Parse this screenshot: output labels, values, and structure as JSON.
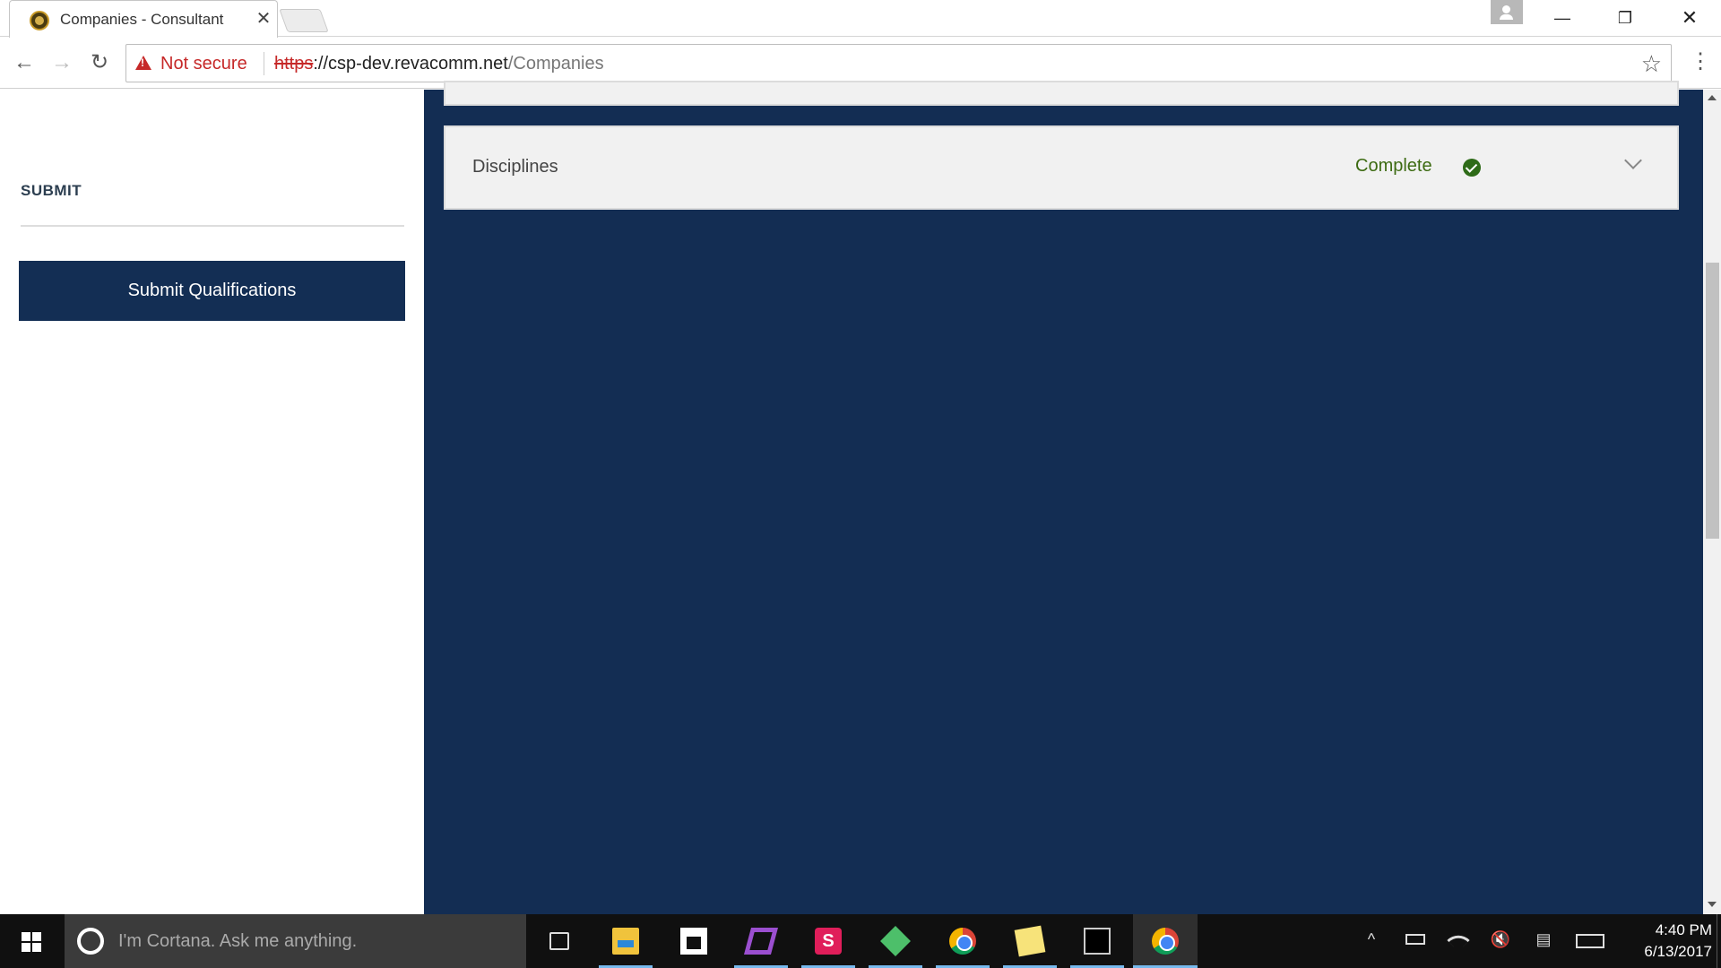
{
  "browser": {
    "tab_title": "Companies - Consultant",
    "tab_close": "✕",
    "url_scheme": "https",
    "url_rest": "://csp-dev.revacomm.net",
    "url_path": "/Companies",
    "security_label": "Not secure",
    "nav": {
      "back": "←",
      "forward": "→",
      "reload": "↻",
      "star": "☆",
      "menu": "⋮"
    },
    "window": {
      "minimize": "—",
      "maximize": "❐",
      "close": "✕"
    }
  },
  "sidebar": {
    "section_heading": "SUBMIT",
    "submit_button": "Submit Qualifications"
  },
  "main": {
    "accordion": {
      "title": "Disciplines",
      "status": "Complete",
      "status_color": "#3d6b12"
    },
    "background_color": "#132d53"
  },
  "taskbar": {
    "cortana_placeholder": "I'm Cortana. Ask me anything.",
    "slack_letter": "S",
    "tray": {
      "chevron": "^",
      "volume": "🔇",
      "notification": "▤"
    },
    "clock_time": "4:40 PM",
    "clock_date": "6/13/2017"
  }
}
